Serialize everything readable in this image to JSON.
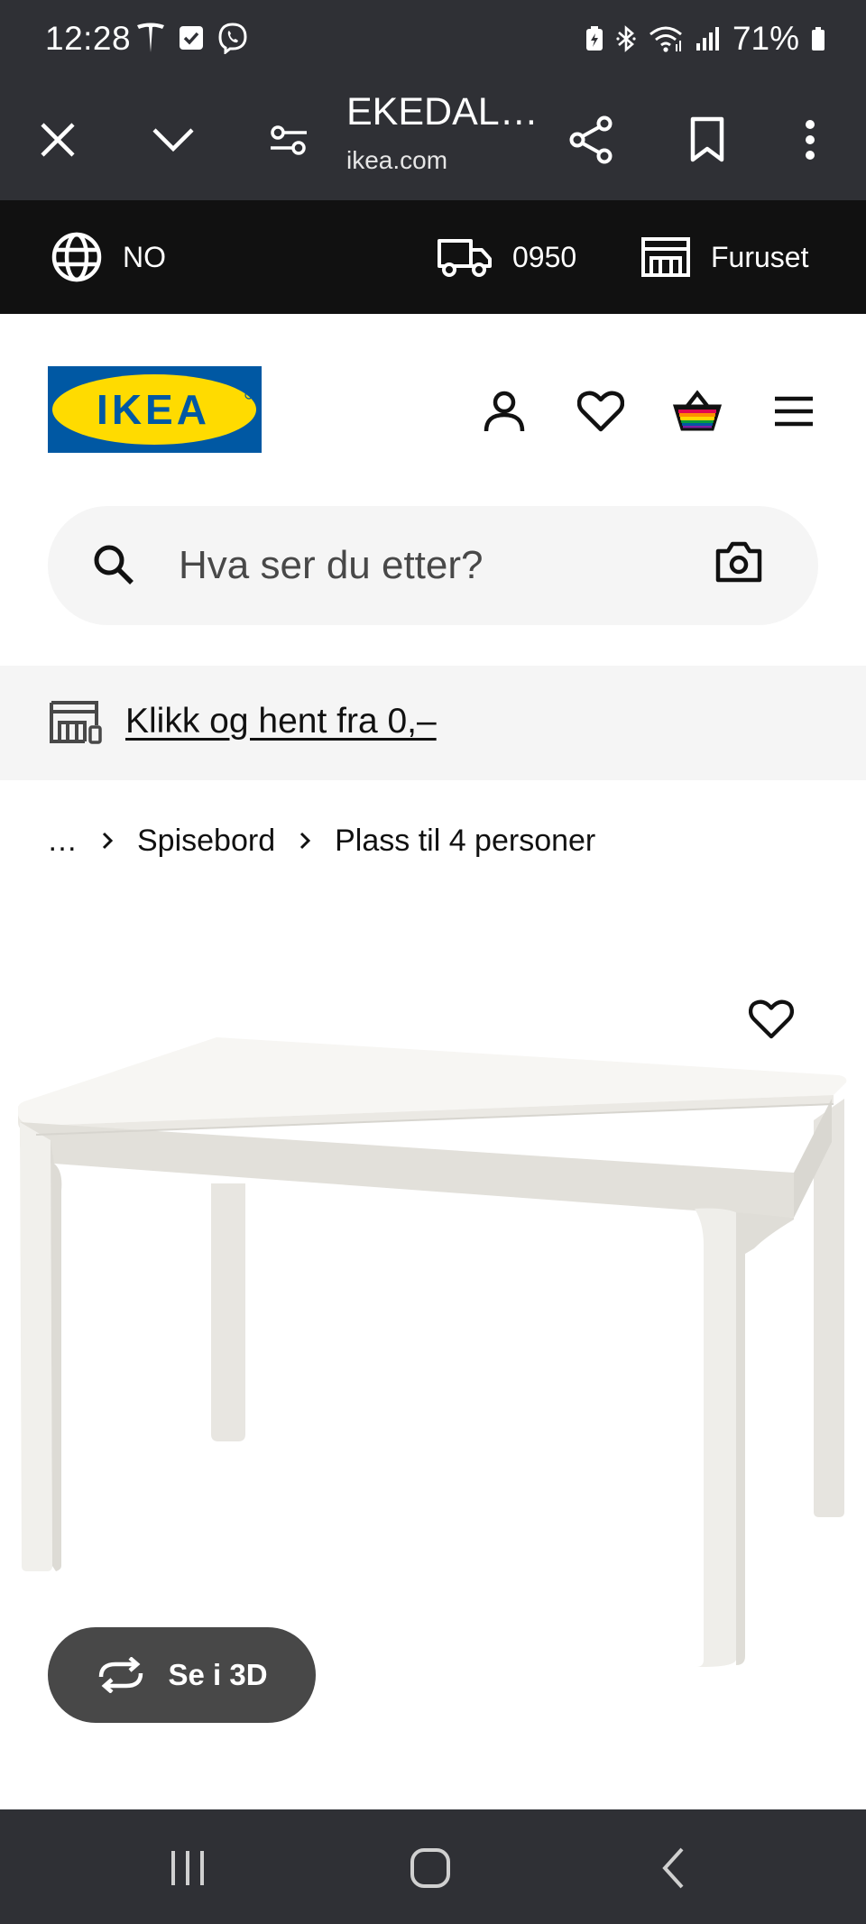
{
  "status_bar": {
    "time": "12:28",
    "battery": "71%",
    "icons": [
      "tesla-icon",
      "checkbox-notification-icon",
      "viber-icon",
      "battery-saver-icon",
      "bluetooth-icon",
      "wifi-icon",
      "signal-icon",
      "battery-icon"
    ]
  },
  "browser": {
    "title": "EKEDAL…",
    "url": "ikea.com",
    "buttons": [
      "close-icon",
      "chevron-down-icon",
      "site-settings-icon",
      "share-icon",
      "bookmark-icon",
      "more-vert-icon"
    ]
  },
  "top_strip": {
    "language": "NO",
    "postcode": "0950",
    "store": "Furuset"
  },
  "header": {
    "logo_text": "IKEA",
    "icons": [
      "profile-icon",
      "heart-icon",
      "basket-icon",
      "menu-icon"
    ]
  },
  "search": {
    "placeholder": "Hva ser du etter?"
  },
  "promo": {
    "text": "Klikk og hent fra 0,–"
  },
  "breadcrumb": {
    "ellipsis": "…",
    "items": [
      "Spisebord",
      "Plass til 4 personer"
    ]
  },
  "product": {
    "image_alt": "EKEDALEN white extendable dining table",
    "view_3d_label": "Se i 3D"
  },
  "colors": {
    "system_bar": "#2f3035",
    "top_strip": "#111111",
    "ikea_blue": "#0058a3",
    "ikea_yellow": "#ffdb00",
    "light_grey": "#f5f5f5",
    "button_dark": "#484848"
  }
}
